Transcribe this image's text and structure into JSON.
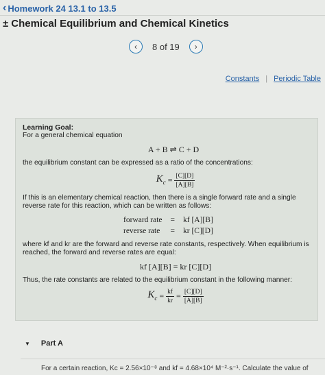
{
  "nav": {
    "back_label": "Homework 24 13.1 to 13.5"
  },
  "title": {
    "prefix": "±",
    "text": "Chemical Equilibrium and Chemical Kinetics"
  },
  "pager": {
    "prev": "‹",
    "count": "8 of 19",
    "next": "›"
  },
  "links": {
    "constants": "Constants",
    "separator": "|",
    "periodic": "Periodic Table"
  },
  "goal": {
    "heading": "Learning Goal:",
    "intro": "For a general chemical equation",
    "reaction": "A + B ⇌ C + D",
    "p2": "the equilibrium constant can be expressed as a ratio of the concentrations:",
    "kc_symbol": "K",
    "kc_sub": "c",
    "eq": "=",
    "kc_num": "[C][D]",
    "kc_den": "[A][B]",
    "p3": "If this is an elementary chemical reaction, then there is a single forward rate and a single reverse rate for this reaction, which can be written as follows:",
    "rates": [
      {
        "label": "forward rate",
        "eq": "=",
        "expr": "kf [A][B]"
      },
      {
        "label": "reverse rate",
        "eq": "=",
        "expr": "kr [C][D]"
      }
    ],
    "p4": "where kf and kr are the forward and reverse rate constants, respectively. When equilibrium is reached, the forward and reverse rates are equal:",
    "balance": "kf [A][B] = kr [C][D]",
    "p5": "Thus, the rate constants are related to the equilibrium constant in the following manner:",
    "ratio_num": "kf",
    "ratio_den": "kr"
  },
  "part_a": {
    "label": "Part A"
  },
  "bottom": {
    "text": "For a certain reaction, Kc = 2.56×10⁻⁸ and kf = 4.68×10⁴ M⁻²·s⁻¹. Calculate the value of"
  }
}
